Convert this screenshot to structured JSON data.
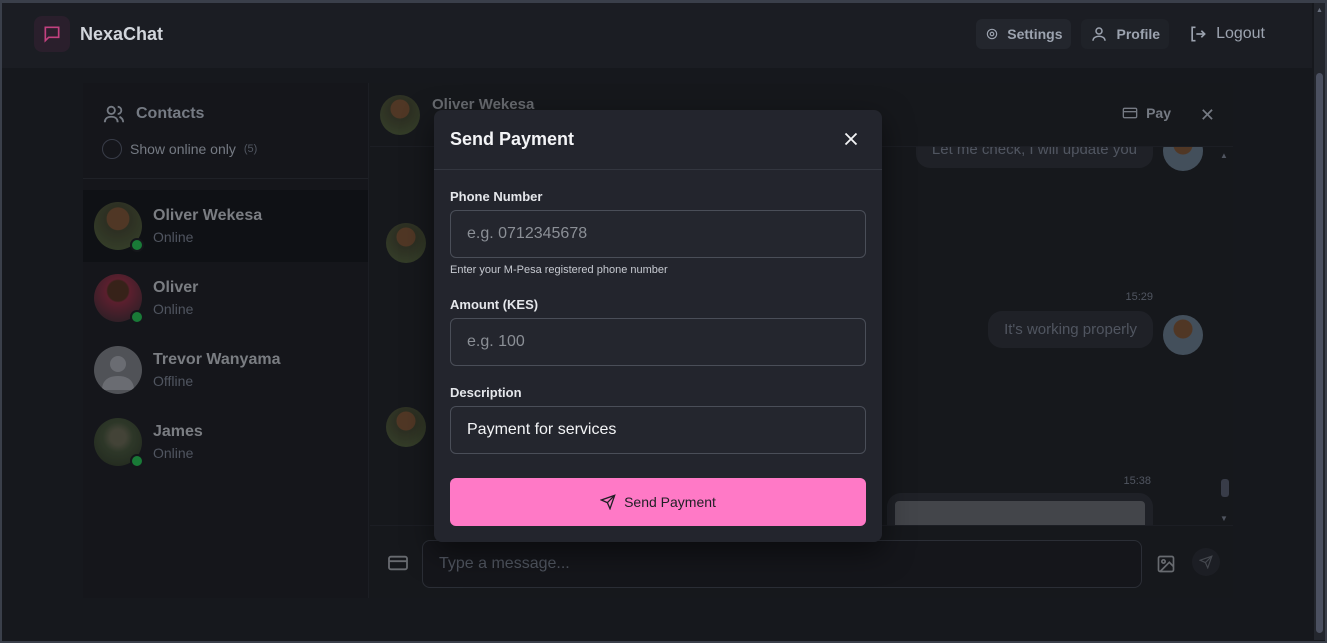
{
  "app": {
    "name": "NexaChat"
  },
  "header": {
    "settings_label": "Settings",
    "profile_label": "Profile",
    "logout_label": "Logout"
  },
  "contacts": {
    "title": "Contacts",
    "online_only_label": "Show online only",
    "online_count": "(5)",
    "items": [
      {
        "name": "Oliver Wekesa",
        "status": "Online"
      },
      {
        "name": "Oliver",
        "status": "Online"
      },
      {
        "name": "Trevor Wanyama",
        "status": "Offline"
      },
      {
        "name": "James",
        "status": "Online"
      }
    ]
  },
  "chat": {
    "contact_name": "Oliver Wekesa",
    "pay_label": "Pay",
    "messages": [
      {
        "text": "Let me check, I will update you"
      },
      {
        "time": "15:29",
        "text": "It's working properly"
      },
      {
        "time": "15:38"
      }
    ],
    "input_placeholder": "Type a message..."
  },
  "modal": {
    "title": "Send Payment",
    "phone_label": "Phone Number",
    "phone_placeholder": "e.g. 0712345678",
    "phone_hint": "Enter your M-Pesa registered phone number",
    "amount_label": "Amount (KES)",
    "amount_placeholder": "e.g. 100",
    "description_label": "Description",
    "description_value": "Payment for services",
    "submit_label": "Send Payment"
  },
  "colors": {
    "accent": "#ff79c6",
    "online": "#22a34a",
    "background": "#16181d"
  }
}
